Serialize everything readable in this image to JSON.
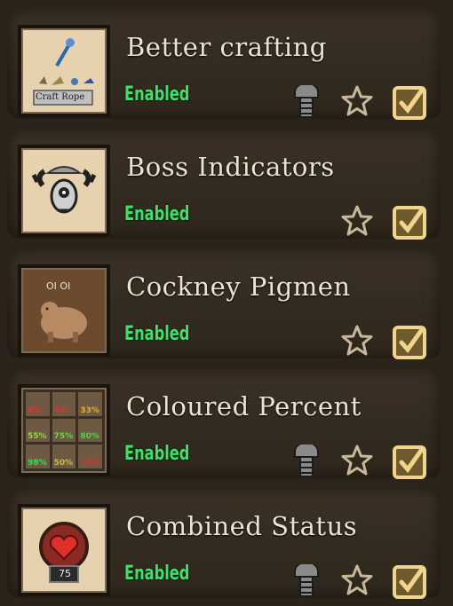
{
  "mods": [
    {
      "name": "Better crafting",
      "status": "Enabled",
      "has_settings": true,
      "icon": "rope-crafting-icon",
      "icon_caption": "Craft Rope"
    },
    {
      "name": "Boss Indicators",
      "status": "Enabled",
      "has_settings": false,
      "icon": "deerclops-icon"
    },
    {
      "name": "Cockney Pigmen",
      "status": "Enabled",
      "has_settings": false,
      "icon": "pigman-icon",
      "icon_caption": "OI OI"
    },
    {
      "name": "Coloured Percent",
      "status": "Enabled",
      "has_settings": true,
      "icon": "coloured-percent-grid-icon",
      "icon_cells": [
        "6%",
        "4%",
        "33%",
        "55%",
        "75%",
        "80%",
        "98%",
        "50%",
        "10%"
      ]
    },
    {
      "name": "Combined Status",
      "status": "Enabled",
      "has_settings": true,
      "icon": "heart-status-icon",
      "icon_caption": "75"
    }
  ],
  "colors": {
    "status": "#3fe06a",
    "title": "#ece3d3",
    "panel": "#342b20",
    "checkbox": "#f1d58e",
    "star": "#c7b89c"
  }
}
